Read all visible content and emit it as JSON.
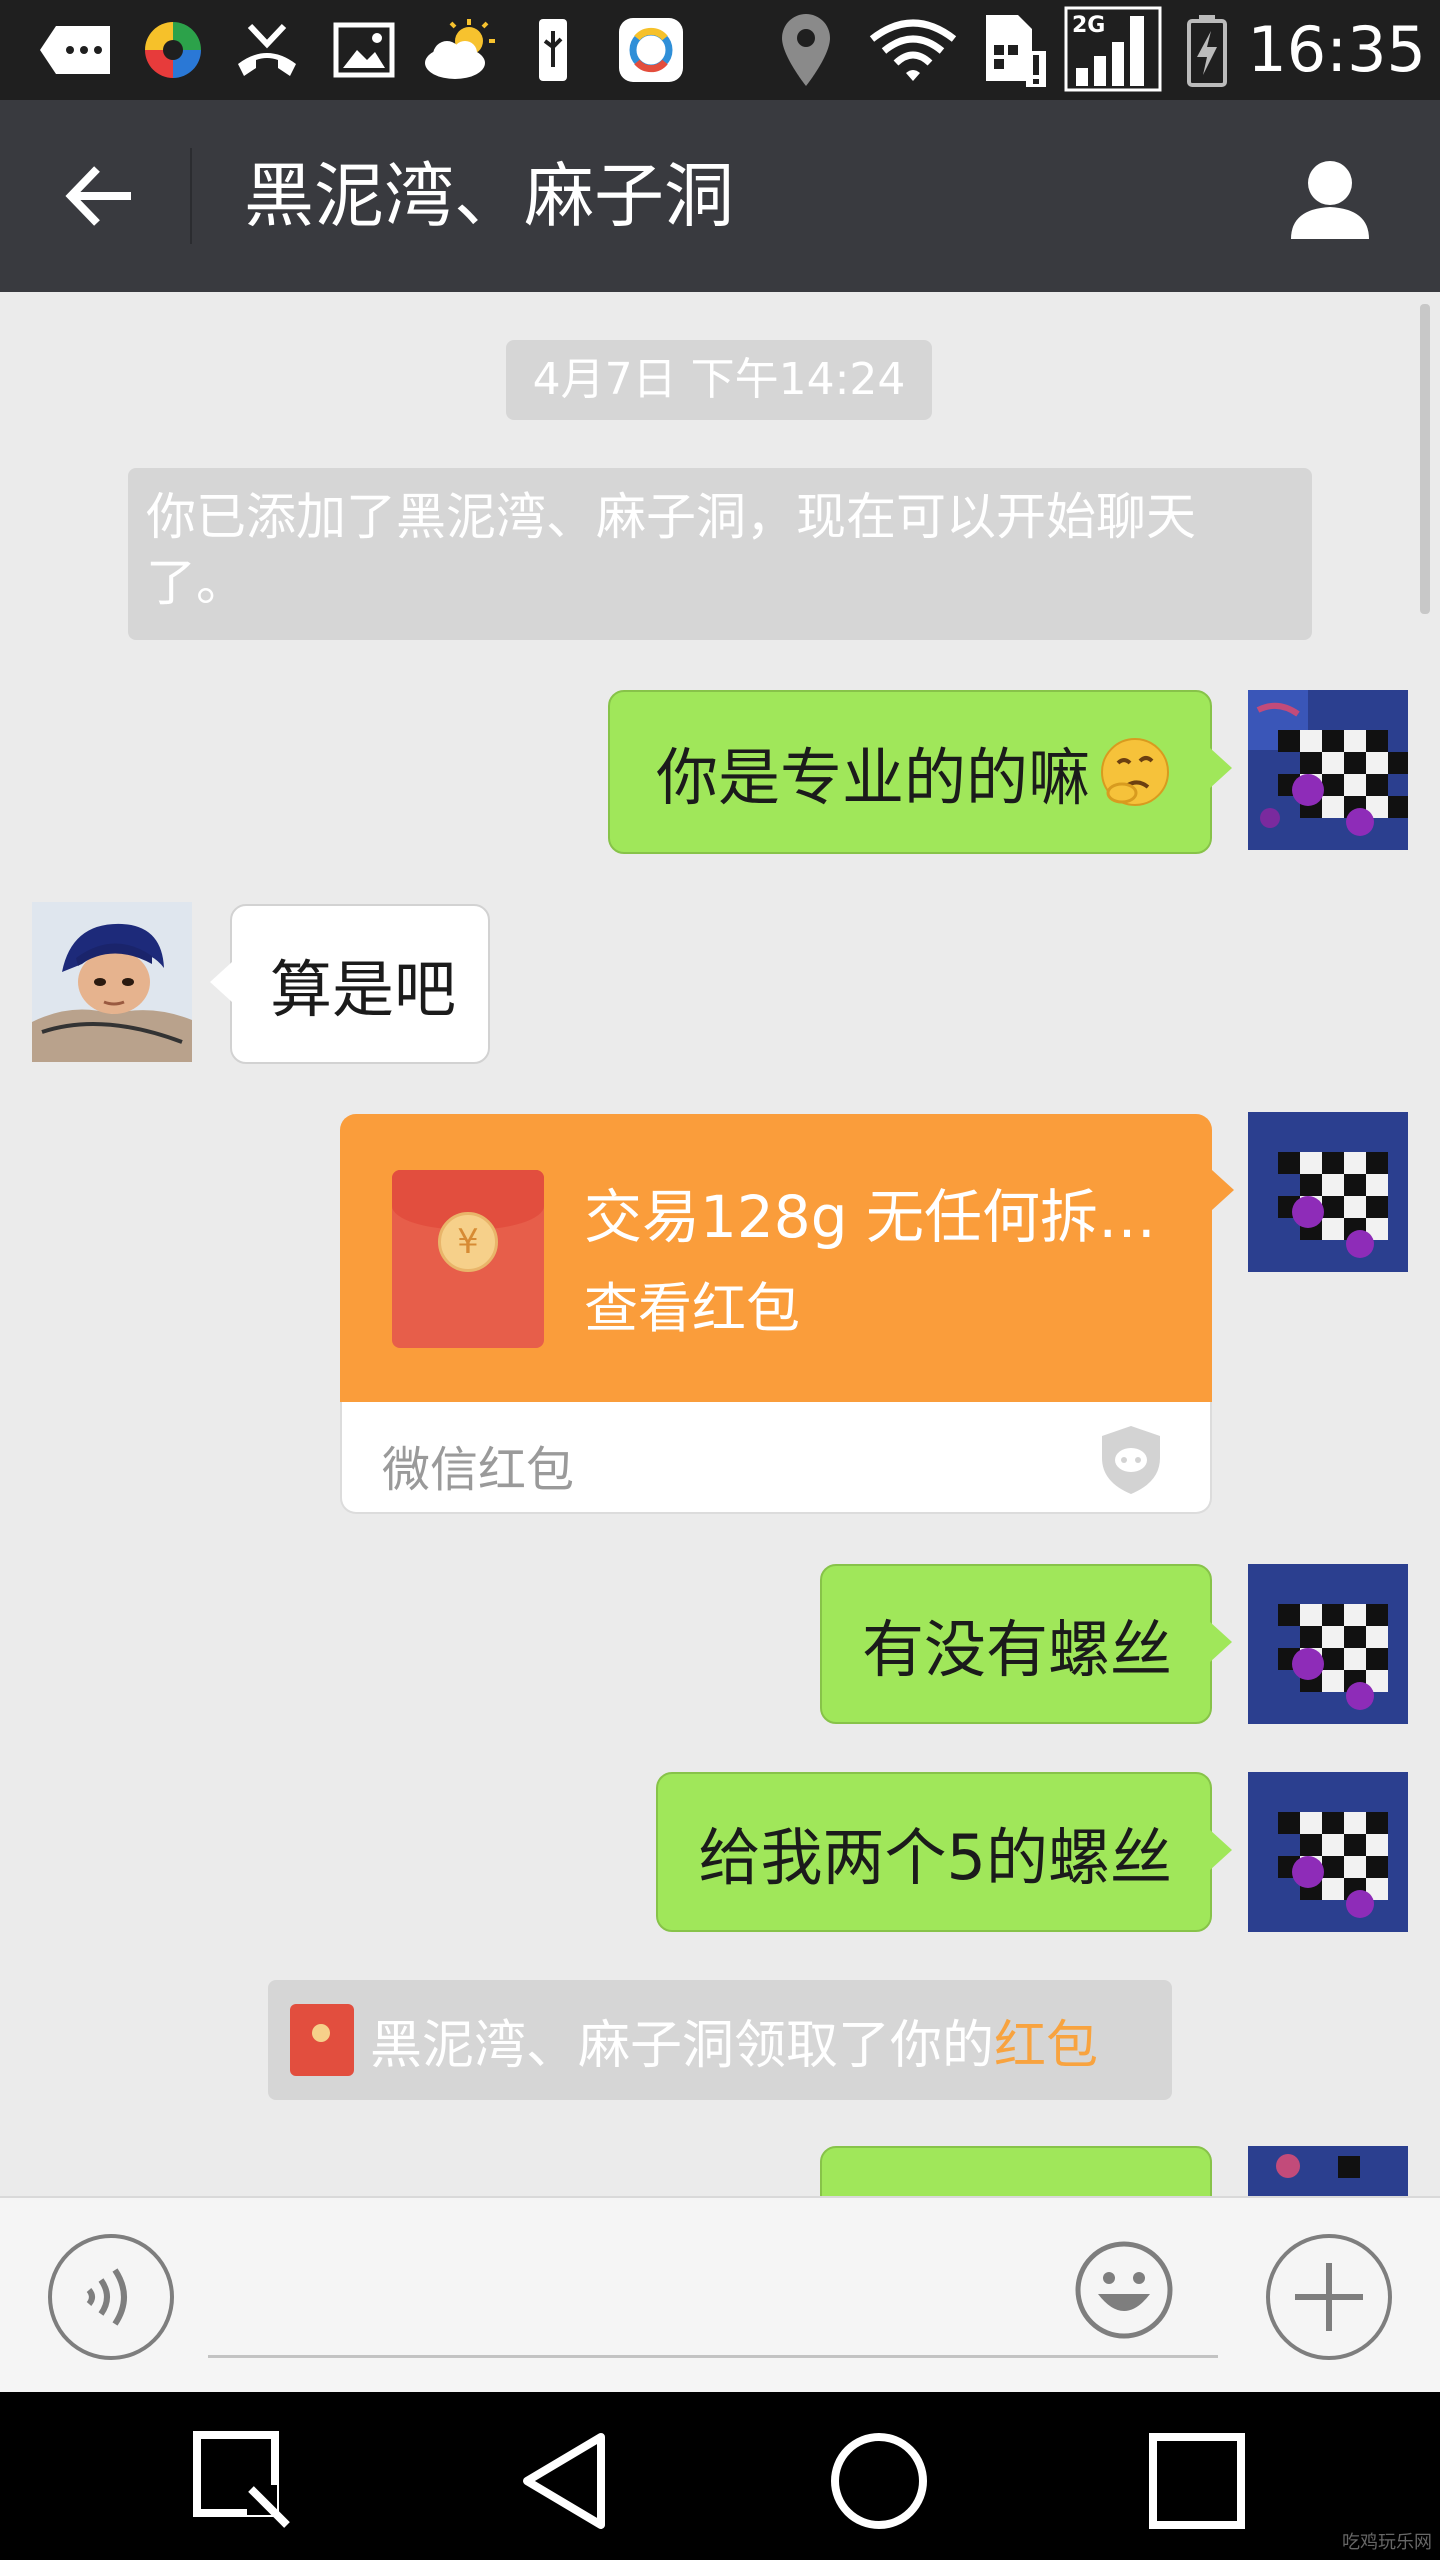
{
  "status_bar": {
    "time": "16:35",
    "network": "2G",
    "icons": [
      "more-icon",
      "app-icon",
      "missed-call-icon",
      "gallery-icon",
      "weather-icon",
      "usb-icon",
      "browser-icon",
      "location-icon",
      "wifi-icon",
      "sim-alert-icon",
      "signal-icon",
      "battery-charging-icon"
    ]
  },
  "header": {
    "title": "黑泥湾、麻子洞",
    "back_icon": "arrow-left-icon",
    "profile_icon": "person-icon"
  },
  "chat": {
    "timestamp": "4月7日 下午14:24",
    "system_message": "你已添加了黑泥湾、麻子洞，现在可以开始聊天了。",
    "messages": [
      {
        "sender": "me",
        "text": "你是专业的的嘛",
        "emoji": "thinking-face-emoji"
      },
      {
        "sender": "other",
        "text": "算是吧"
      },
      {
        "sender": "me",
        "type": "red_packet",
        "title": "交易128g 无任何拆…",
        "action": "查看红包",
        "brand": "微信红包"
      },
      {
        "sender": "me",
        "text": "有没有螺丝"
      },
      {
        "sender": "me",
        "text": "给我两个5的螺丝"
      }
    ],
    "receipt": {
      "text": "黑泥湾、麻子洞领取了你的",
      "link": "红包"
    }
  },
  "input_bar": {
    "placeholder": "",
    "voice_icon": "voice-icon",
    "emoji_icon": "smiley-icon",
    "plus_icon": "plus-icon"
  },
  "nav_bar": {
    "buttons": [
      "search-icon",
      "back-triangle-icon",
      "home-circle-icon",
      "recents-square-icon"
    ]
  },
  "watermark": "吃鸡玩乐网",
  "colors": {
    "header_bg": "#393a3f",
    "chat_bg": "#ebebeb",
    "my_bubble": "#a0e75a",
    "red_packet": "#fa9d3b",
    "link": "#f8a33f"
  }
}
